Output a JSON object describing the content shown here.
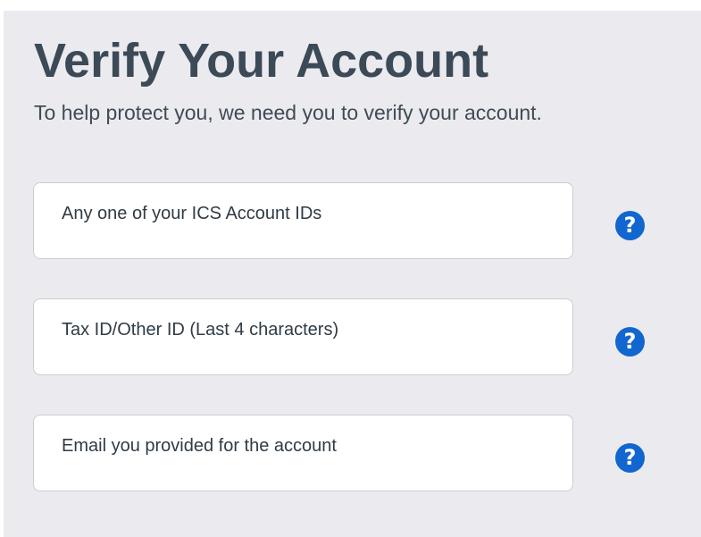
{
  "header": {
    "title": "Verify Your Account",
    "subtitle": "To help protect you, we need you to verify your account."
  },
  "form": {
    "fields": [
      {
        "placeholder": "Any one of your ICS Account IDs",
        "value": "",
        "help_icon": "question-circle-icon"
      },
      {
        "placeholder": "Tax ID/Other ID (Last 4 characters)",
        "value": "",
        "help_icon": "question-circle-icon"
      },
      {
        "placeholder": "Email you provided for the account",
        "value": "",
        "help_icon": "question-circle-icon"
      }
    ],
    "help_glyph": "?"
  },
  "colors": {
    "background": "#ebebef",
    "title": "#3c4a57",
    "help_icon": "#1266cf",
    "field_border": "#c9cdd2"
  }
}
